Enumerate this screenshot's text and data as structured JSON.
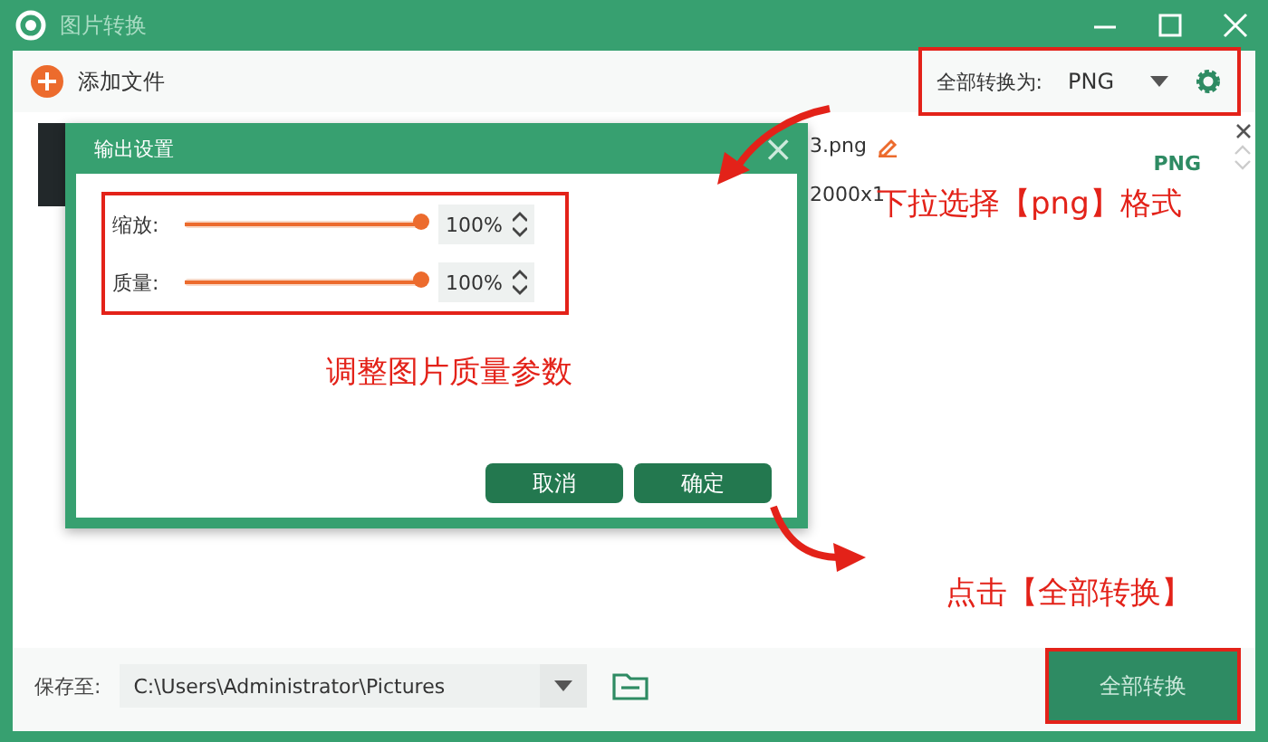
{
  "window": {
    "title": "图片转换"
  },
  "toolbar": {
    "add_button": "添加文件",
    "convert_all_label": "全部转换为:",
    "format_dropdown": {
      "value": "PNG"
    }
  },
  "files": [
    {
      "name": "3.png",
      "size": "2000x1",
      "format": "PNG"
    }
  ],
  "dialog": {
    "title": "输出设置",
    "close": "×",
    "settings": [
      {
        "label": "缩放:",
        "level": 1.0,
        "value": "100%"
      },
      {
        "label": "质量:",
        "level": 1.0,
        "value": "100%"
      }
    ],
    "buttons": [
      "取消",
      "确定"
    ]
  },
  "annotations": [
    {
      "text": "下拉选择【png】格式",
      "kind": "format"
    },
    {
      "text": "调整图片质量参数",
      "kind": "quality"
    },
    {
      "text": "点击【全部转换】",
      "kind": "convert"
    }
  ],
  "bottom_bar": {
    "save_label": "保存至:",
    "path": "C:\\Users\\Administrator\\Pictures",
    "convert_button": "全部转换"
  }
}
